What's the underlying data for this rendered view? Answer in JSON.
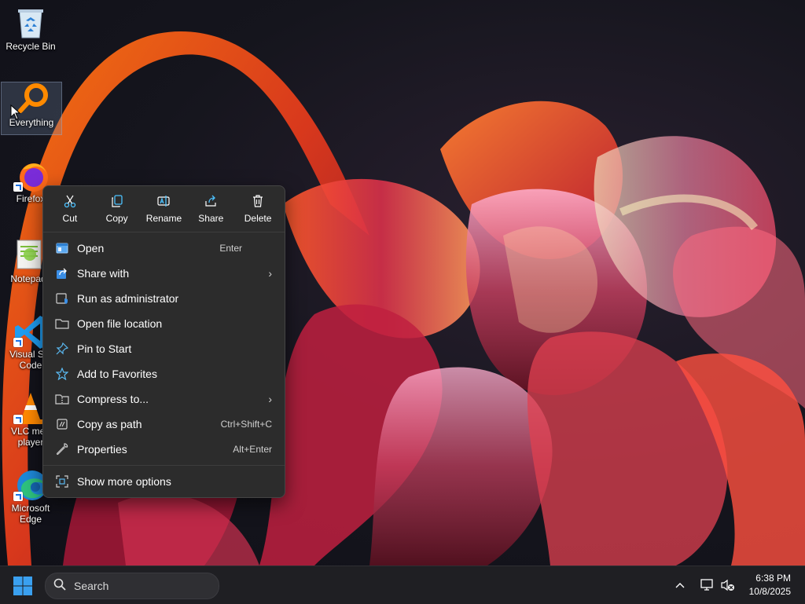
{
  "desktop": {
    "icons": [
      {
        "label": "Recycle Bin"
      },
      {
        "label": "Everything"
      },
      {
        "label": "Firefox"
      },
      {
        "label": "Notepad"
      },
      {
        "label": "Visual Stu",
        "label2": "Code"
      },
      {
        "label": "VLC med",
        "label2": "player"
      },
      {
        "label": "Microsoft",
        "label2": "Edge"
      }
    ]
  },
  "context_menu": {
    "quick_actions": [
      {
        "label": "Cut",
        "icon": "cut-icon"
      },
      {
        "label": "Copy",
        "icon": "copy-icon"
      },
      {
        "label": "Rename",
        "icon": "rename-icon"
      },
      {
        "label": "Share",
        "icon": "share-icon"
      },
      {
        "label": "Delete",
        "icon": "delete-icon"
      }
    ],
    "items": [
      {
        "label": "Open",
        "shortcut": "Enter",
        "icon": "open-icon"
      },
      {
        "label": "Share with",
        "submenu": "›",
        "icon": "share-with-icon"
      },
      {
        "label": "Run as administrator",
        "icon": "shield-icon"
      },
      {
        "label": "Open file location",
        "icon": "folder-icon"
      },
      {
        "label": "Pin to Start",
        "icon": "pin-icon"
      },
      {
        "label": "Add to Favorites",
        "icon": "star-icon"
      },
      {
        "label": "Compress to...",
        "submenu": "›",
        "icon": "zip-folder-icon"
      },
      {
        "label": "Copy as path",
        "shortcut": "Ctrl+Shift+C",
        "icon": "copy-path-icon"
      },
      {
        "label": "Properties",
        "shortcut": "Alt+Enter",
        "icon": "wrench-icon"
      },
      {
        "label": "Show more options",
        "icon": "more-options-icon"
      }
    ]
  },
  "taskbar": {
    "search_placeholder": "Search",
    "tray_expand": "^",
    "time": "6:38 PM",
    "date": "10/8/2025"
  },
  "colors": {
    "menu_bg": "#2c2c2c",
    "taskbar_bg": "#1f1f23",
    "accent": "#4cc2ff",
    "windows_blue": "#3aa0f0"
  }
}
